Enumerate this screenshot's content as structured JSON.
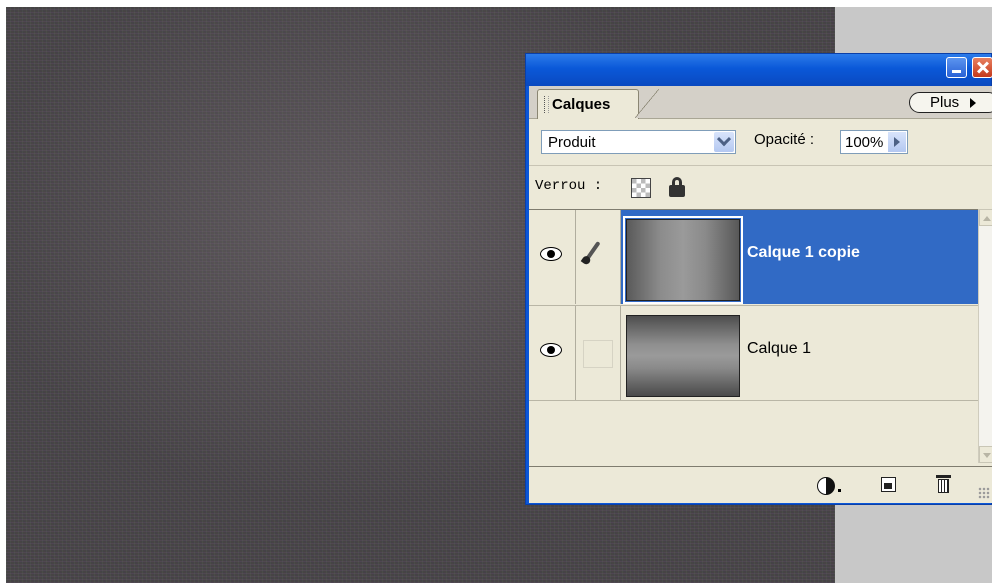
{
  "panel": {
    "tab_label": "Calques",
    "more_label": "Plus",
    "blend_mode": "Produit",
    "opacity_label": "Opacité :",
    "opacity_value": "100%",
    "lock_label": "Verrou :"
  },
  "layers": [
    {
      "name": "Calque 1 copie",
      "selected": true,
      "visible": true,
      "linked_brush": true
    },
    {
      "name": "Calque 1",
      "selected": false,
      "visible": true,
      "linked_brush": false
    }
  ],
  "icons": {
    "minimize": "minimize-icon",
    "close": "close-icon",
    "eye": "eye-icon",
    "brush": "brush-icon",
    "lock_transparency": "checkerboard-icon",
    "lock_all": "padlock-icon",
    "layer_styles": "layer-style-icon",
    "new_layer": "new-layer-icon",
    "delete_layer": "trash-icon"
  },
  "colors": {
    "titlebar": "#0a58d8",
    "selection": "#316ac5",
    "panel_bg": "#ece9d8"
  }
}
